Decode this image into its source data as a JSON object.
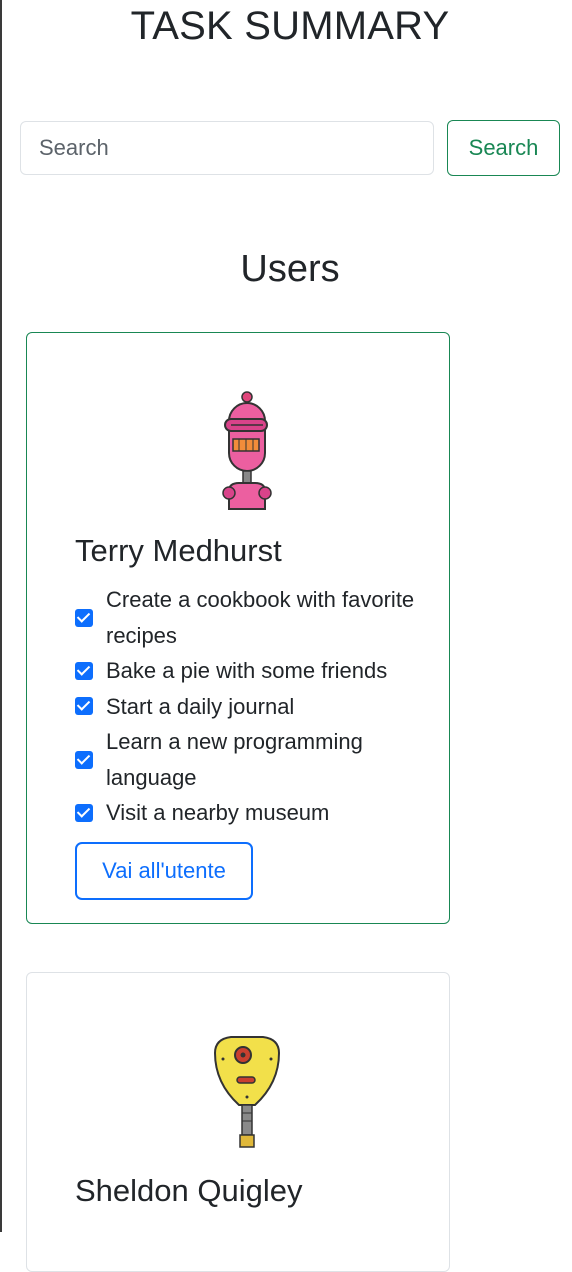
{
  "header": {
    "title": "TASK SUMMARY"
  },
  "search": {
    "placeholder": "Search",
    "value": "",
    "button_label": "Search"
  },
  "users_section": {
    "title": "Users"
  },
  "users": [
    {
      "name": "Terry Medhurst",
      "avatar": "pink-robot-avatar",
      "todos": [
        {
          "text": "Create a cookbook with favorite recipes",
          "completed": true
        },
        {
          "text": "Bake a pie with some friends",
          "completed": true
        },
        {
          "text": "Start a daily journal",
          "completed": true
        },
        {
          "text": "Learn a new programming language",
          "completed": true
        },
        {
          "text": "Visit a nearby museum",
          "completed": true
        }
      ],
      "button_label": "Vai all'utente"
    },
    {
      "name": "Sheldon Quigley",
      "avatar": "yellow-robot-avatar"
    }
  ],
  "colors": {
    "accent_green": "#198754",
    "accent_blue": "#0d6efd",
    "text": "#212529",
    "border": "#dee2e6"
  }
}
